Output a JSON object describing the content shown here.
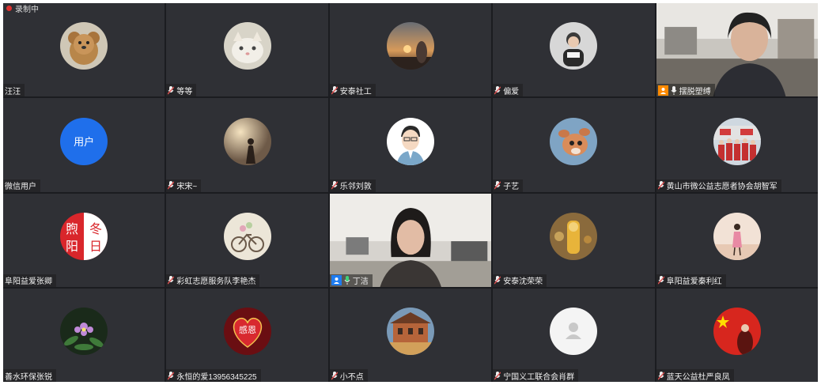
{
  "recording": {
    "label": "录制中"
  },
  "colors": {
    "accent_active": "#3fd17a",
    "mic_muted": "#e05050",
    "mic_active": "#3fd17a",
    "host_badge": "#ff8a00",
    "self_badge": "#1e7cf0"
  },
  "participants": [
    {
      "name": "汪汪",
      "avatar": "dog-avatar",
      "mic": "none"
    },
    {
      "name": "等等",
      "avatar": "cat-avatar",
      "mic": "muted"
    },
    {
      "name": "安泰社工",
      "avatar": "sunset-avatar",
      "mic": "muted"
    },
    {
      "name": "偏爱",
      "avatar": "person-avatar",
      "mic": "muted"
    },
    {
      "name": "摆脱塑缚",
      "avatar": "live-video",
      "mic": "on",
      "badge": "host"
    },
    {
      "name": "微信用户",
      "avatar": "text-avatar",
      "avatar_text": "用户",
      "mic": "none"
    },
    {
      "name": "宋宋~",
      "avatar": "silhouette-avatar",
      "mic": "muted"
    },
    {
      "name": "乐邻刘敦",
      "avatar": "cartoon-man-avatar",
      "mic": "muted"
    },
    {
      "name": "子艺",
      "avatar": "deer-avatar",
      "mic": "muted"
    },
    {
      "name": "黄山市微公益志愿者协会胡智军",
      "avatar": "group-avatar",
      "mic": "muted"
    },
    {
      "name": "阜阳益爱张卿",
      "avatar": "winter-sun-avatar",
      "avatar_text": "煦冬阳日",
      "mic": "none"
    },
    {
      "name": "彩虹志愿服务队李艳杰",
      "avatar": "bicycle-avatar",
      "mic": "muted"
    },
    {
      "name": "丁洁",
      "avatar": "live-video",
      "mic": "active",
      "badge": "self",
      "active": true
    },
    {
      "name": "安泰沈荣荣",
      "avatar": "toy-avatar",
      "mic": "muted"
    },
    {
      "name": "阜阳益爱秦利红",
      "avatar": "walk-avatar",
      "mic": "muted"
    },
    {
      "name": "善水环保张锐",
      "avatar": "flower-avatar",
      "mic": "none"
    },
    {
      "name": "永恒的爱13956345225",
      "avatar": "heart-avatar",
      "avatar_text": "感恩",
      "mic": "muted"
    },
    {
      "name": "小不点",
      "avatar": "building-avatar",
      "mic": "muted"
    },
    {
      "name": "宁国义工联合会肖群",
      "avatar": "default-avatar",
      "mic": "muted"
    },
    {
      "name": "蓝天公益杜严良凤",
      "avatar": "flag-avatar",
      "mic": "muted"
    }
  ]
}
